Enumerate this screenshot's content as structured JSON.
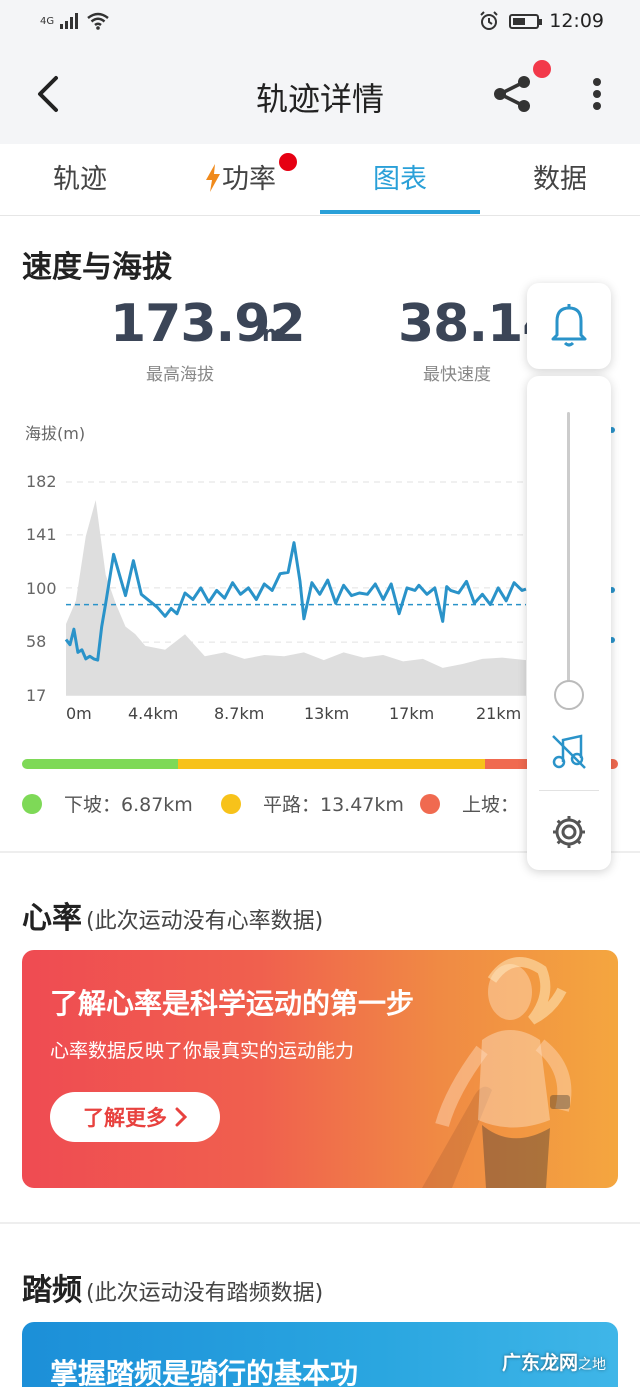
{
  "status_bar": {
    "network": "4G",
    "time": "12:09"
  },
  "nav": {
    "title": "轨迹详情"
  },
  "tabs": [
    {
      "label": "轨迹",
      "active": false
    },
    {
      "label": "功率",
      "active": false,
      "badge": true
    },
    {
      "label": "图表",
      "active": true
    },
    {
      "label": "数据",
      "active": false
    }
  ],
  "speed_altitude": {
    "title": "速度与海拔",
    "max_altitude": {
      "value": "173.92",
      "unit": "m",
      "label": "最高海拔"
    },
    "max_speed": {
      "value": "38.14",
      "label": "最快速度"
    }
  },
  "road_types": [
    {
      "label": "下坡：6.87km",
      "color": "#7ed957"
    },
    {
      "label": "平路：13.47km",
      "color": "#f7c21a"
    },
    {
      "label": "上坡：",
      "color": "#f06a50"
    }
  ],
  "heart_rate": {
    "title": "心率",
    "note": "(此次运动没有心率数据)",
    "banner_title": "了解心率是科学运动的第一步",
    "banner_sub": "心率数据反映了你最真实的运动能力",
    "banner_button": "了解更多"
  },
  "cadence": {
    "title": "踏频",
    "note": "(此次运动没有踏频数据)",
    "banner_title": "掌握踏频是骑行的基本功"
  },
  "watermark": {
    "main": "广东龙网",
    "small": "之地"
  },
  "chart_data": {
    "type": "line",
    "ylabel": "海拔(m)",
    "yticks": [
      "182",
      "141",
      "100",
      "58",
      "17"
    ],
    "ylim": [
      17,
      182
    ],
    "xticks": [
      "0m",
      "4.4km",
      "8.7km",
      "13km",
      "17km",
      "21km"
    ],
    "xlim": [
      0,
      23.2
    ],
    "grid": true,
    "series": [
      {
        "color": "#2a93c9",
        "x": [
          0,
          0.2,
          0.4,
          0.6,
          0.8,
          1.0,
          1.2,
          1.4,
          1.6,
          1.8,
          2.0,
          2.4,
          2.7,
          3.0,
          3.4,
          3.8,
          4.2,
          4.6,
          5.0,
          5.3,
          5.6,
          6.0,
          6.4,
          6.8,
          7.2,
          7.6,
          8.0,
          8.4,
          8.8,
          9.2,
          9.6,
          10.0,
          10.4,
          10.8,
          11.2,
          11.5,
          11.8,
          12.0,
          12.4,
          12.8,
          13.2,
          13.6,
          14.0,
          14.4,
          14.8,
          15.2,
          15.6,
          16.0,
          16.4,
          16.8,
          17.2,
          17.6,
          17.8,
          18.2,
          18.6,
          19.0,
          19.2,
          19.4,
          19.8,
          20.2,
          20.6,
          21.0,
          21.4,
          21.8,
          22.2,
          22.6,
          23.0,
          23.2
        ],
        "y": [
          60,
          56,
          68,
          50,
          52,
          45,
          47,
          45,
          44,
          70,
          88,
          126,
          110,
          94,
          121,
          95,
          90,
          85,
          78,
          84,
          80,
          96,
          91,
          100,
          89,
          98,
          92,
          104,
          95,
          100,
          91,
          103,
          98,
          111,
          112,
          135,
          105,
          76,
          104,
          95,
          106,
          88,
          102,
          94,
          96,
          95,
          103,
          91,
          103,
          80,
          100,
          98,
          102,
          95,
          100,
          74,
          101,
          98,
          96,
          105,
          88,
          95,
          87,
          100,
          90,
          104,
          98,
          99
        ]
      },
      {
        "color": "#dedede",
        "x": [
          0,
          0.5,
          1.0,
          1.5,
          2.0,
          2.5,
          3.0,
          3.5,
          4.0,
          5.0,
          6.0,
          7.0,
          8.0,
          9.0,
          10.0,
          11.0,
          12.0,
          13.0,
          14.0,
          15.0,
          16.0,
          17.0,
          18.0,
          19.0,
          20.0,
          21.0,
          22.0,
          23.2
        ],
        "y": [
          72,
          90,
          140,
          168,
          110,
          88,
          70,
          64,
          55,
          52,
          64,
          47,
          50,
          45,
          48,
          47,
          50,
          44,
          50,
          46,
          48,
          43,
          45,
          38,
          41,
          45,
          46,
          44
        ]
      }
    ],
    "reference_line": 87
  }
}
